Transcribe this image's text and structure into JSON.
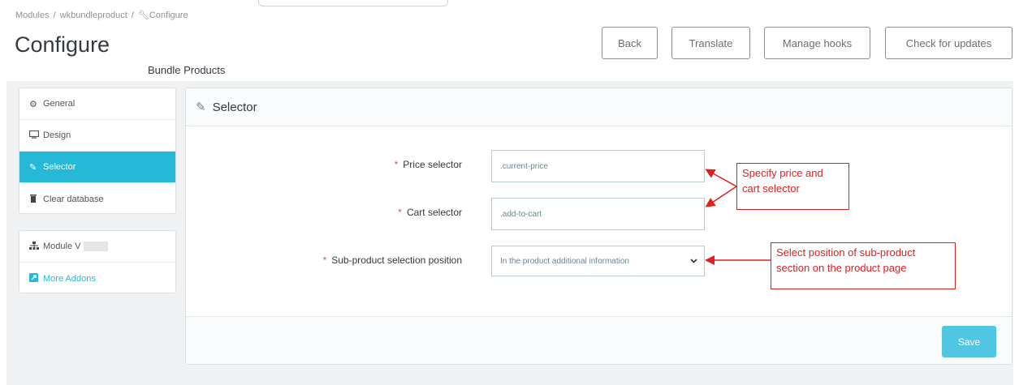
{
  "breadcrumb": {
    "items": [
      "Modules",
      "wkbundleproduct",
      "Configure"
    ],
    "separator": "/"
  },
  "header": {
    "title": "Configure",
    "subtitle": "Bundle Products"
  },
  "toolbar": {
    "back": "Back",
    "translate": "Translate",
    "manage_hooks": "Manage hooks",
    "check_updates": "Check for updates"
  },
  "sidebar": {
    "items": [
      {
        "label": "General",
        "icon": "cogs-icon"
      },
      {
        "label": "Design",
        "icon": "desktop-icon"
      },
      {
        "label": "Selector",
        "icon": "edit-icon",
        "active": true
      },
      {
        "label": "Clear database",
        "icon": "trash-icon"
      }
    ],
    "info": [
      {
        "label": "Module V",
        "icon": "sitemap-icon"
      },
      {
        "label": "More Addons",
        "icon": "external-icon"
      }
    ]
  },
  "panel": {
    "title": "Selector",
    "fields": {
      "price": {
        "label": "Price selector",
        "value": ".current-price",
        "required": "*"
      },
      "cart": {
        "label": "Cart selector",
        "value": ".add-to-cart",
        "required": "*"
      },
      "position": {
        "label": "Sub-product selection position",
        "value": "In the product additional information",
        "required": "*"
      }
    },
    "save": "Save"
  },
  "annotations": {
    "callout1": [
      "Specify price and",
      "cart selector"
    ],
    "callout2": [
      "Select position of sub-product",
      "section on the product page"
    ]
  },
  "colors": {
    "accent": "#25b9d7",
    "save_button": "#50c6e2",
    "annotation": "#e0201f",
    "required": "#c05c67"
  }
}
